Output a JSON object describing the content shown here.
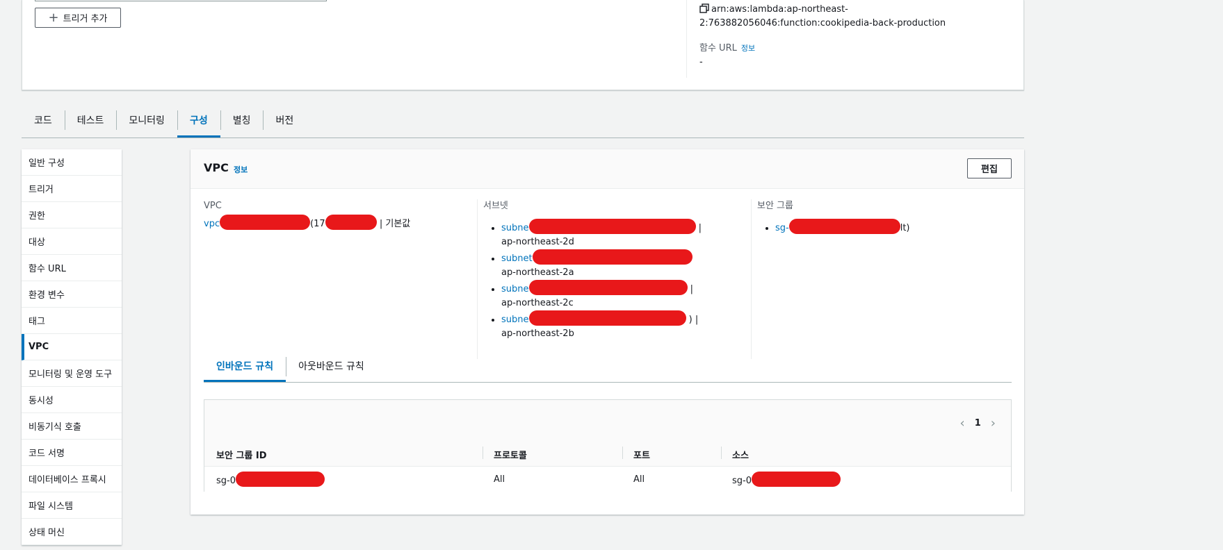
{
  "top_panel": {
    "add_trigger_label": "트리거 추가",
    "arn_value": "arn:aws:lambda:ap-northeast-2:763882056046:function:cookipedia-back-production",
    "function_url_label": "함수 URL",
    "function_url_info": "정보",
    "function_url_value": "-"
  },
  "main_tabs": [
    "코드",
    "테스트",
    "모니터링",
    "구성",
    "별칭",
    "버전"
  ],
  "main_tabs_active": "구성",
  "side_nav": [
    "일반 구성",
    "트리거",
    "권한",
    "대상",
    "함수 URL",
    "환경 변수",
    "태그",
    "VPC",
    "모니터링 및 운영 도구",
    "동시성",
    "비동기식 호출",
    "코드 서명",
    "데이터베이스 프록시",
    "파일 시스템",
    "상태 머신"
  ],
  "side_nav_active": "VPC",
  "vpc_panel": {
    "title": "VPC",
    "info": "정보",
    "edit_label": "편집",
    "vpc_label": "VPC",
    "vpc_prefix": "vpc",
    "vpc_cidr_prefix": "(17",
    "vpc_suffix": "| 기본값",
    "subnet_label": "서브넷",
    "subnets": [
      {
        "prefix": "subne",
        "suffix": "| ap-northeast-2d"
      },
      {
        "prefix": "subnet",
        "suffix": "ap-northeast-2a"
      },
      {
        "prefix": "subne",
        "suffix": "| ap-northeast-2c"
      },
      {
        "prefix": "subne",
        "suffix": ") | ap-northeast-2b"
      }
    ],
    "sg_label": "보안 그룹",
    "sg_prefix": "sg-",
    "sg_suffix": "lt)"
  },
  "rule_tabs": [
    "인바운드 규칙",
    "아웃바운드 규칙"
  ],
  "rule_tabs_active": "인바운드 규칙",
  "rules_table": {
    "page": "1",
    "columns": [
      "보안 그룹 ID",
      "프로토콜",
      "포트",
      "소스"
    ],
    "rows": [
      {
        "sg_id": "sg-0",
        "protocol": "All",
        "port": "All",
        "source": "sg-0"
      }
    ]
  },
  "colors": {
    "accent": "#0073bb",
    "redaction": "#e8181a"
  }
}
